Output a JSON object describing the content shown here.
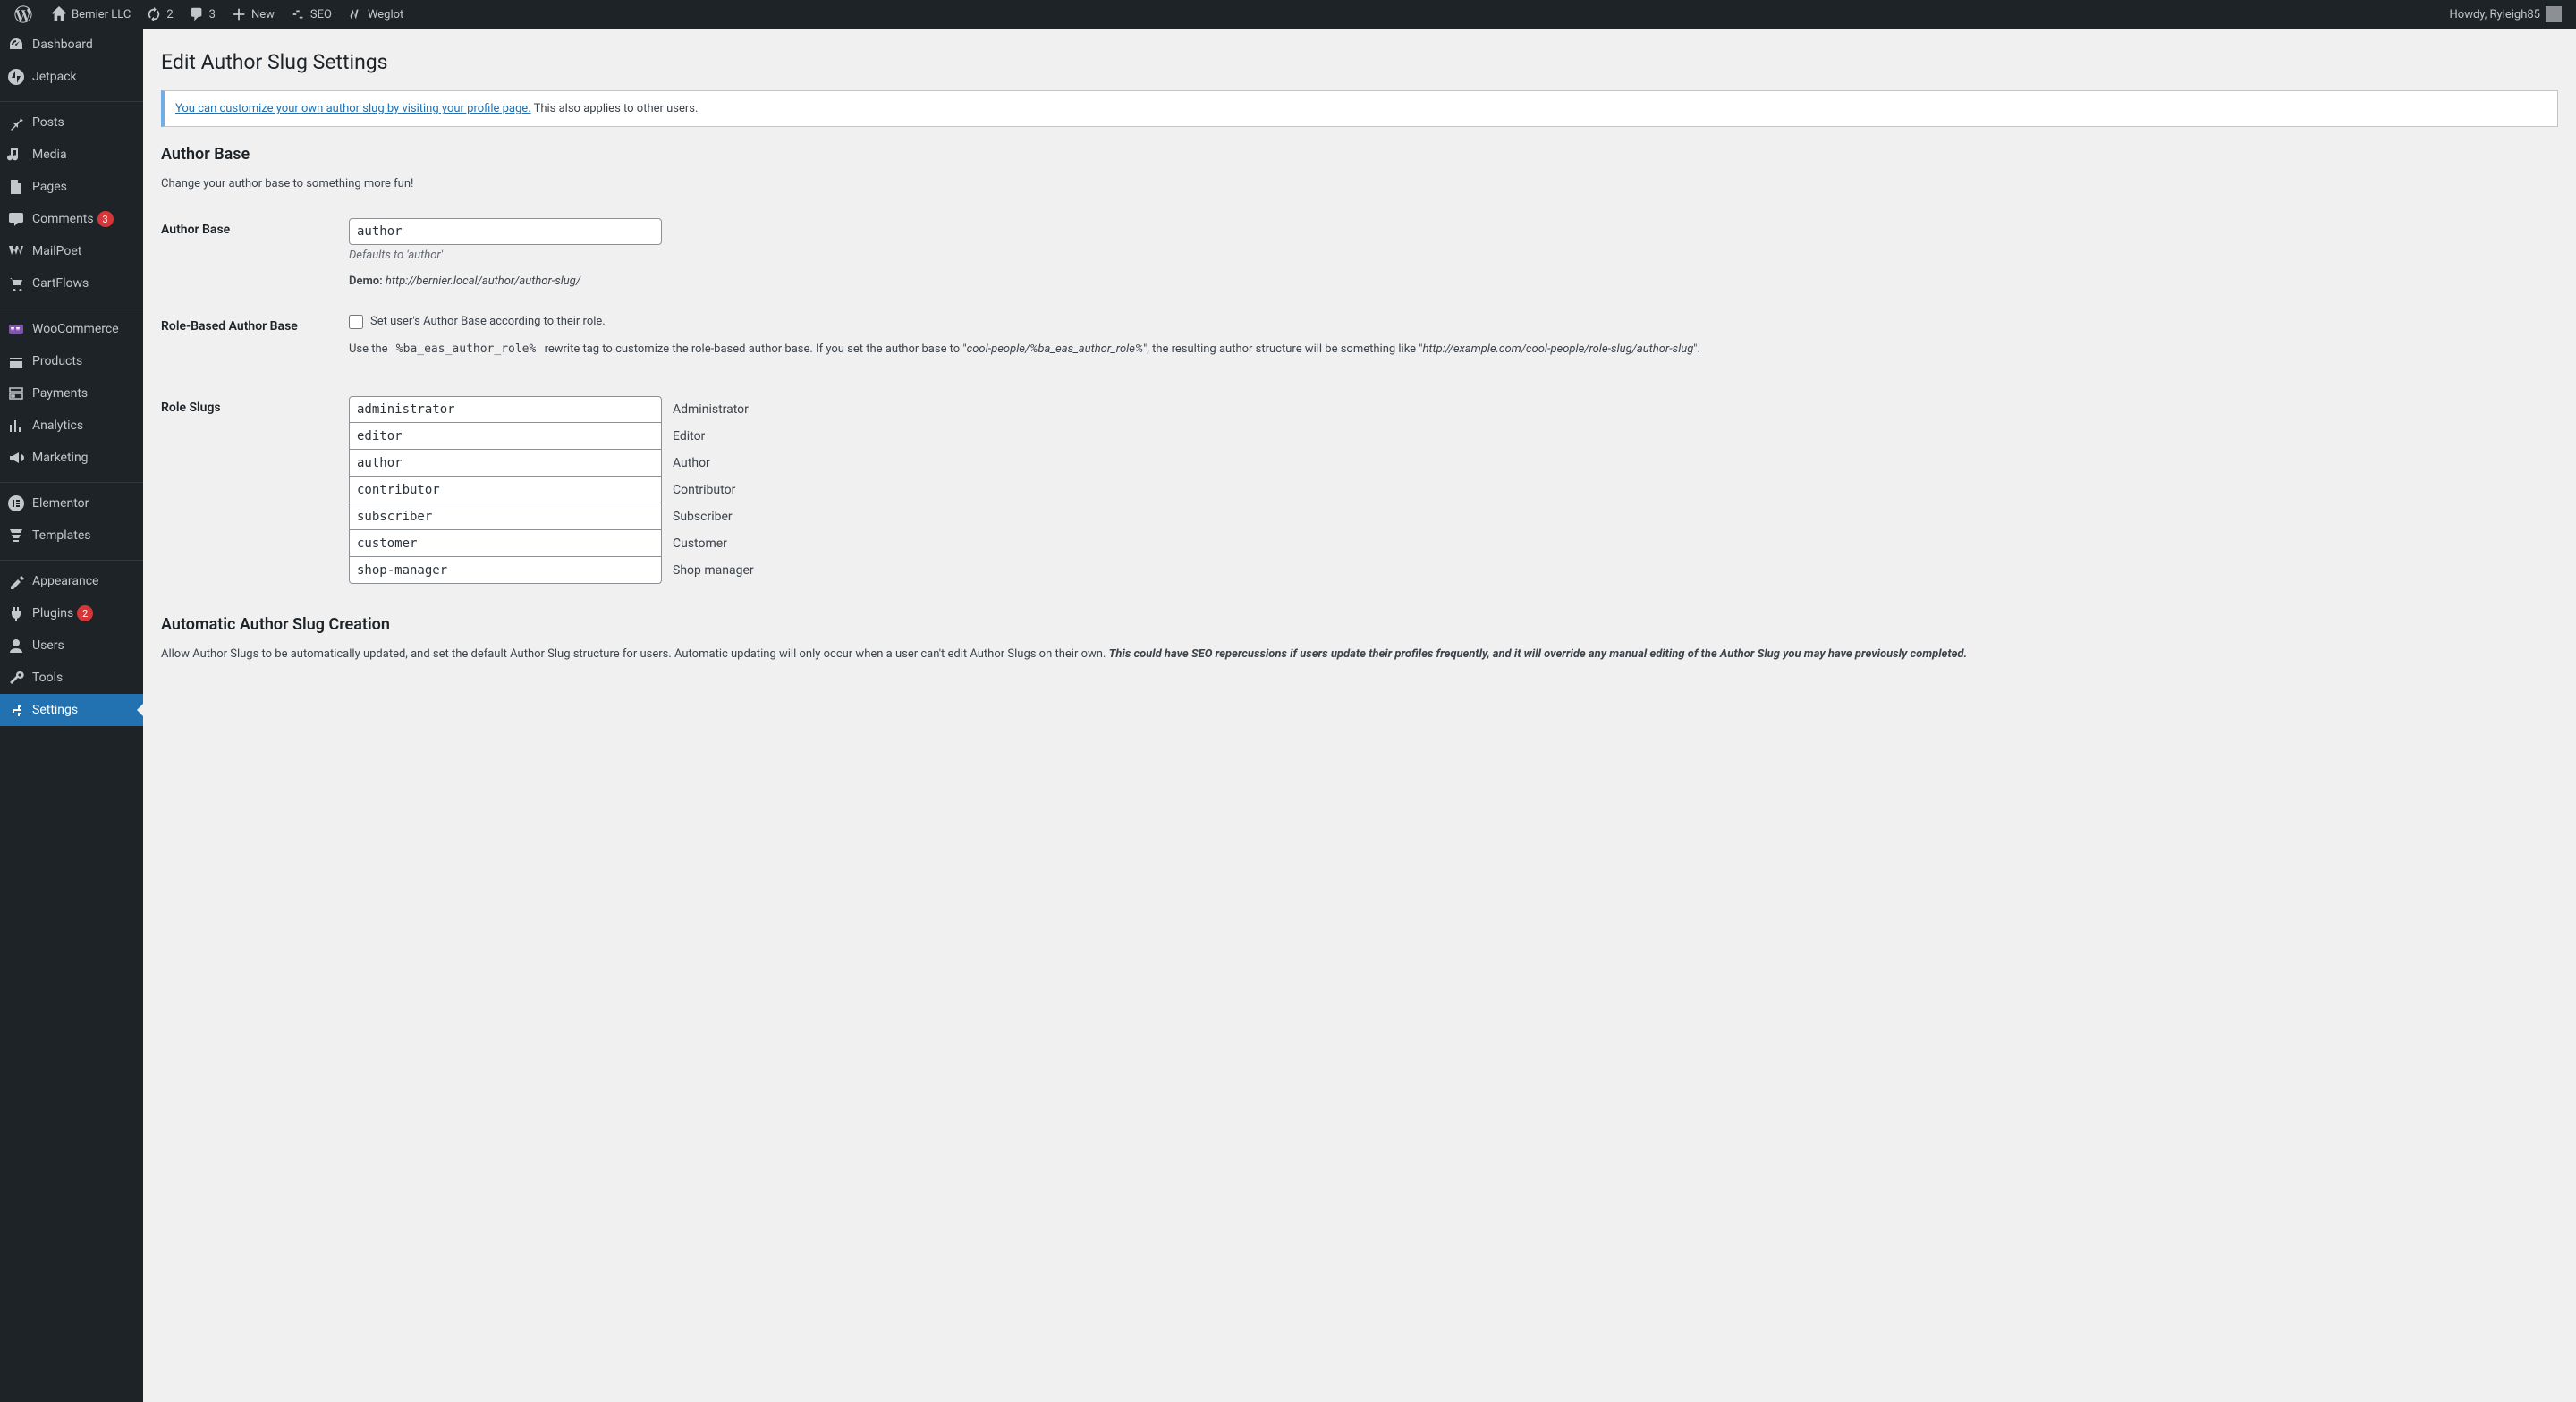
{
  "adminbar": {
    "site_name": "Bernier LLC",
    "updates_count": "2",
    "comments_count": "3",
    "new_label": "New",
    "seo_label": "SEO",
    "weglot_label": "Weglot",
    "howdy": "Howdy, Ryleigh85"
  },
  "menu": {
    "dashboard": "Dashboard",
    "jetpack": "Jetpack",
    "posts": "Posts",
    "media": "Media",
    "pages": "Pages",
    "comments": "Comments",
    "comments_badge": "3",
    "mailpoet": "MailPoet",
    "cartflows": "CartFlows",
    "woocommerce": "WooCommerce",
    "products": "Products",
    "payments": "Payments",
    "analytics": "Analytics",
    "marketing": "Marketing",
    "elementor": "Elementor",
    "templates": "Templates",
    "appearance": "Appearance",
    "plugins": "Plugins",
    "plugins_badge": "2",
    "users": "Users",
    "tools": "Tools",
    "settings": "Settings"
  },
  "page": {
    "title": "Edit Author Slug Settings",
    "notice_link": "You can customize your own author slug by visiting your profile page.",
    "notice_rest": " This also applies to other users.",
    "author_base_heading": "Author Base",
    "author_base_help": "Change your author base to something more fun!",
    "author_base_label": "Author Base",
    "author_base_value": "author",
    "author_base_desc": "Defaults to 'author'",
    "demo_label": "Demo:",
    "demo_url": "http://bernier.local/author/author-slug/",
    "role_base_label": "Role-Based Author Base",
    "role_base_checkbox": "Set user's Author Base according to their role.",
    "role_help_pre": "Use the ",
    "role_help_code": "%ba_eas_author_role%",
    "role_help_mid": " rewrite tag to customize the role-based author base. If you set the author base to \"",
    "role_help_em1": "cool-people/%ba_eas_author_role%",
    "role_help_mid2": "\", the resulting author structure will be something like \"",
    "role_help_em2": "http://example.com/cool-people/role-slug/author-slug",
    "role_help_end": "\".",
    "role_slugs_label": "Role Slugs",
    "roles": [
      {
        "value": "administrator",
        "label": "Administrator"
      },
      {
        "value": "editor",
        "label": "Editor"
      },
      {
        "value": "author",
        "label": "Author"
      },
      {
        "value": "contributor",
        "label": "Contributor"
      },
      {
        "value": "subscriber",
        "label": "Subscriber"
      },
      {
        "value": "customer",
        "label": "Customer"
      },
      {
        "value": "shop-manager",
        "label": "Shop manager"
      }
    ],
    "auto_heading": "Automatic Author Slug Creation",
    "auto_p1": "Allow Author Slugs to be automatically updated, and set the default Author Slug structure for users. Automatic updating will only occur when a user can't edit Author Slugs on their own. ",
    "auto_p2": "This could have SEO repercussions if users update their profiles frequently, and it will override any manual editing of the Author Slug you may have previously completed."
  }
}
